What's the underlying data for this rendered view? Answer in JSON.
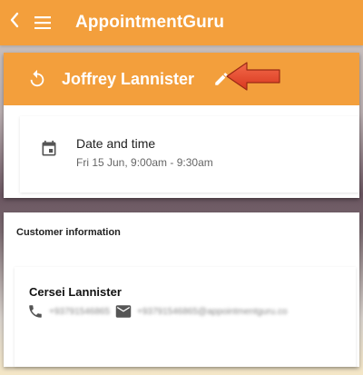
{
  "appbar": {
    "back_icon": "back-chevron-icon",
    "menu_icon": "hamburger-menu-icon",
    "title": "AppointmentGuru"
  },
  "appointment": {
    "client_name": "Joffrey Lannister",
    "date_time_label": "Date and time",
    "date_time_value": "Fri 15 Jun, 9:00am - 9:30am"
  },
  "customer": {
    "heading": "Customer information",
    "name": "Cersei Lannister",
    "phone": "+93791546865",
    "email": "+93791546865@appointmentguru.co"
  },
  "colors": {
    "accent": "#f39f3c",
    "arrow": "#e8452a"
  }
}
